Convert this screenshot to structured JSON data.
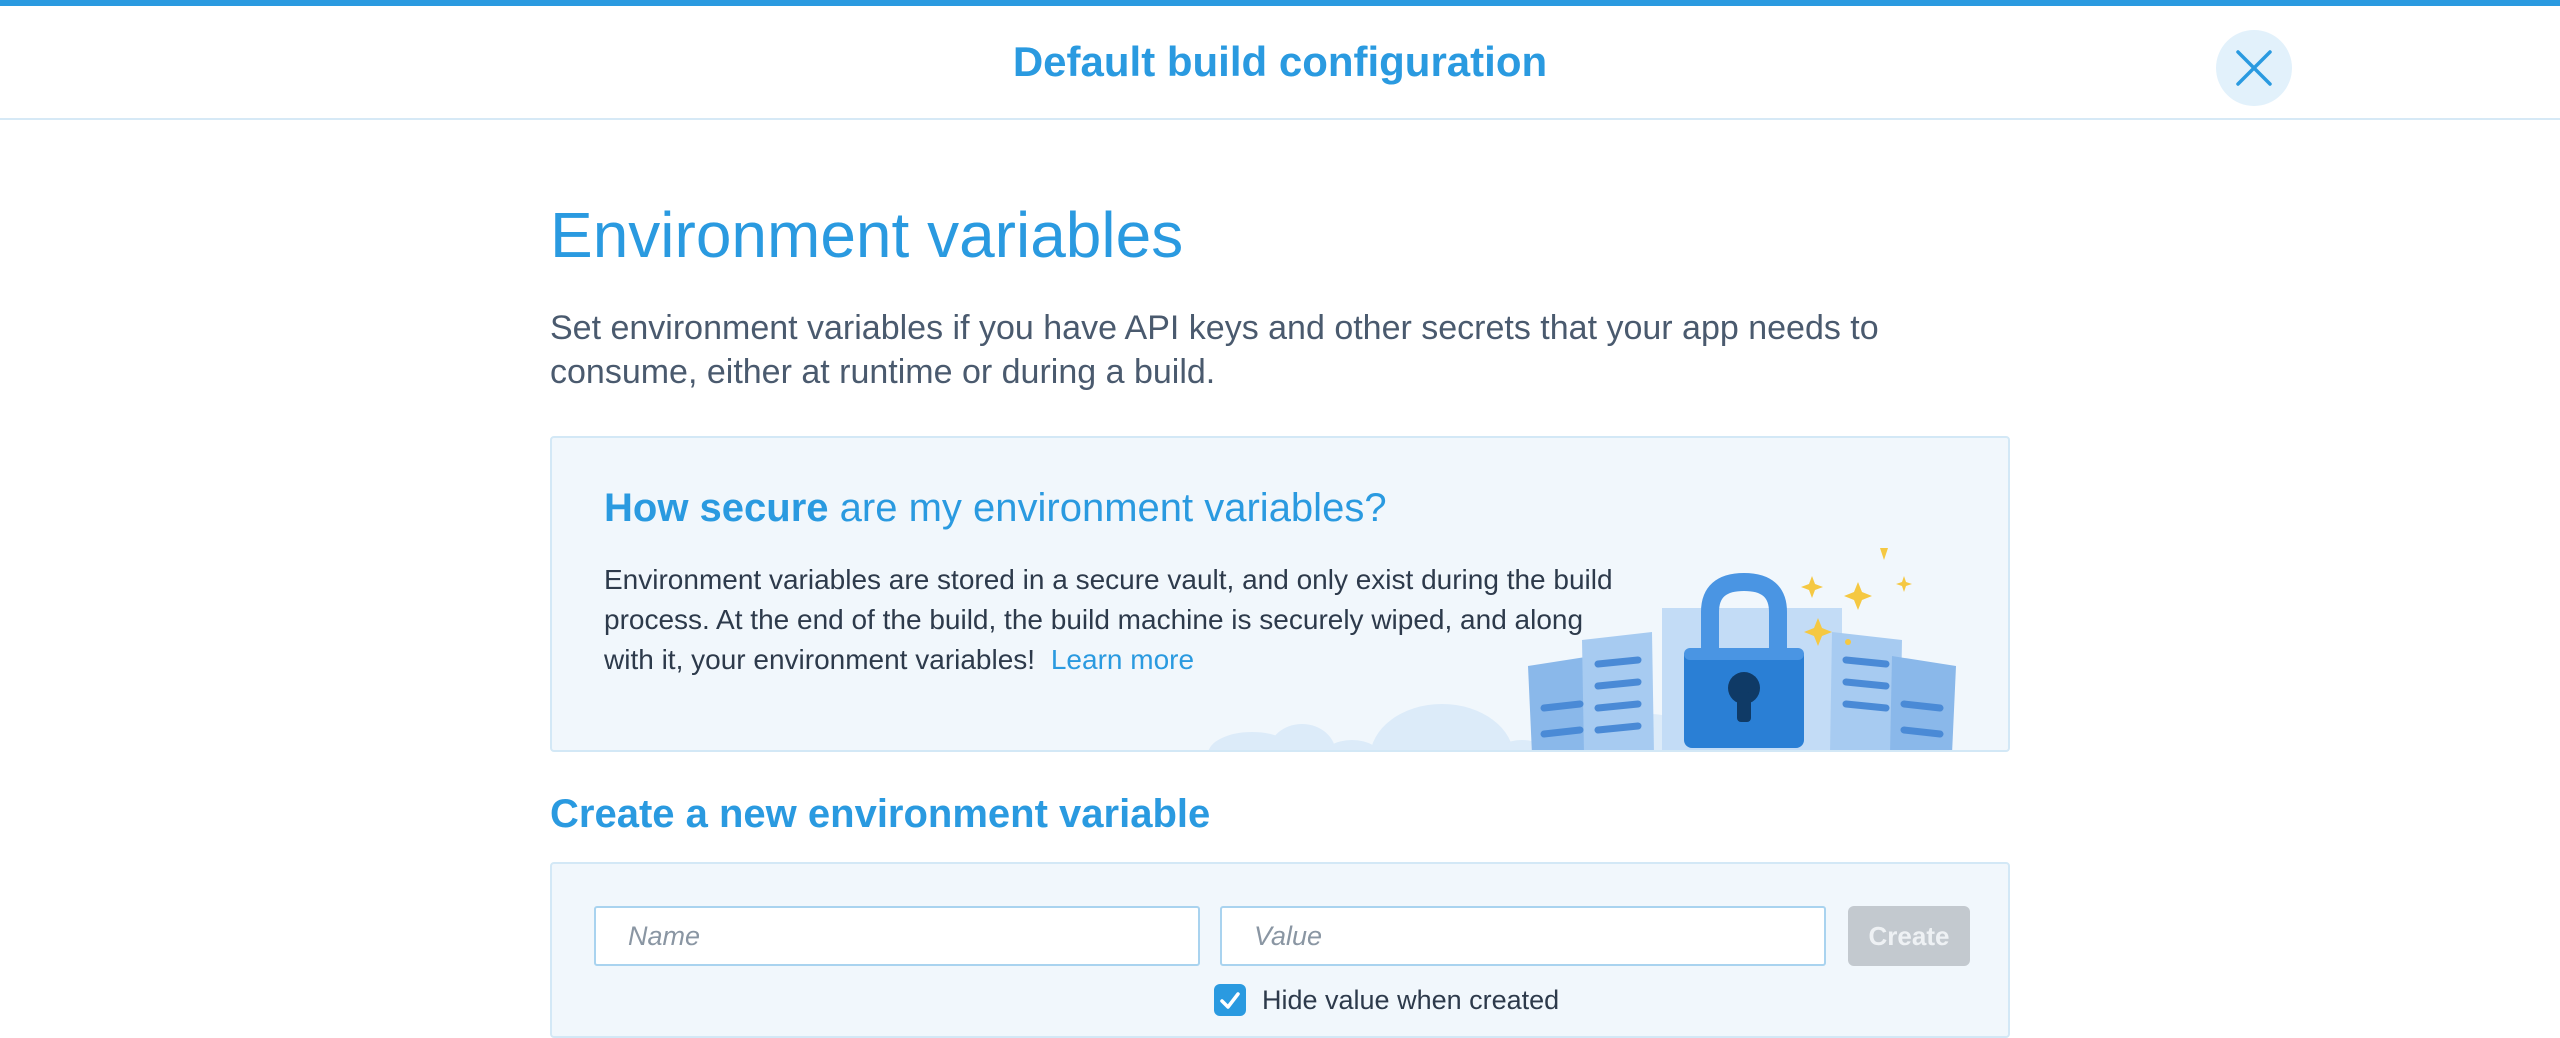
{
  "modal": {
    "title": "Default build configuration",
    "close_icon": "close-icon"
  },
  "section": {
    "title": "Environment variables",
    "intro": "Set environment variables if you have API keys and other secrets that your app needs to consume, either at runtime or during a build."
  },
  "info": {
    "heading_bold": "How secure",
    "heading_rest": " are my environment variables?",
    "text": "Environment variables are stored in a secure vault, and only exist during the build process. At the end of the build, the build machine is securely wiped, and along with it, your environment variables!",
    "link": "Learn more",
    "illustration": "padlock-vault-illustration"
  },
  "create": {
    "heading_bold": "Create a new",
    "heading_rest": " environment variable",
    "name_placeholder": "Name",
    "value_placeholder": "Value",
    "button": "Create",
    "hide_label": "Hide value when created",
    "hide_checked": true
  },
  "colors": {
    "accent": "#2a9ae0",
    "card_bg": "#f1f7fc",
    "disabled_button": "#c3c9cf"
  }
}
